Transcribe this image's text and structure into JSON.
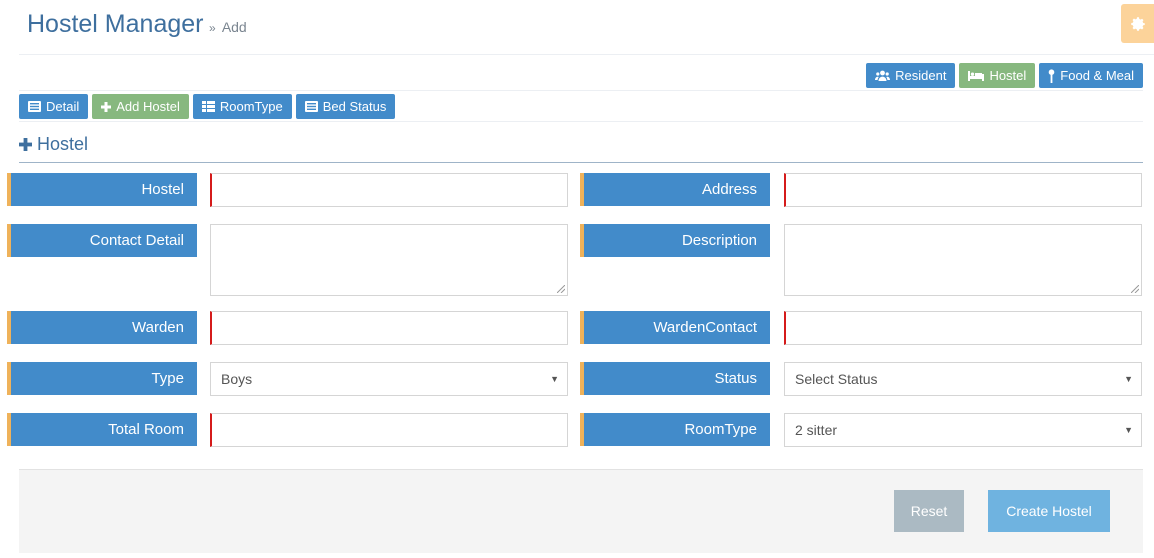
{
  "header": {
    "title": "Hostel Manager",
    "breadcrumb_sep": "»",
    "breadcrumb": "Add",
    "settings_icon": "gear-icon"
  },
  "topnav": [
    {
      "label": "Resident",
      "icon": "users-icon",
      "color": "#428bca"
    },
    {
      "label": "Hostel",
      "icon": "bed-icon",
      "color": "#87b87f"
    },
    {
      "label": "Food & Meal",
      "icon": "key-icon",
      "color": "#428bca"
    }
  ],
  "subnav": [
    {
      "label": "Detail",
      "icon": "list-icon",
      "color": "#428bca"
    },
    {
      "label": "Add Hostel",
      "icon": "plus-icon",
      "color": "#87b87f"
    },
    {
      "label": "RoomType",
      "icon": "table-icon",
      "color": "#428bca"
    },
    {
      "label": "Bed Status",
      "icon": "list-icon",
      "color": "#428bca"
    }
  ],
  "section": {
    "title": "Hostel",
    "icon": "plus-icon"
  },
  "form": {
    "hostel": {
      "label": "Hostel",
      "value": ""
    },
    "address": {
      "label": "Address",
      "value": ""
    },
    "contact_detail": {
      "label": "Contact Detail",
      "value": ""
    },
    "description": {
      "label": "Description",
      "value": ""
    },
    "warden": {
      "label": "Warden",
      "value": ""
    },
    "warden_contact": {
      "label": "WardenContact",
      "value": ""
    },
    "type": {
      "label": "Type",
      "selected": "Boys"
    },
    "status": {
      "label": "Status",
      "selected": "Select Status"
    },
    "total_room": {
      "label": "Total Room",
      "value": ""
    },
    "room_type": {
      "label": "RoomType",
      "selected": "2 sitter"
    }
  },
  "actions": {
    "reset": "Reset",
    "create": "Create Hostel"
  },
  "colors": {
    "primary": "#428bca",
    "success": "#87b87f",
    "accent": "#efb25a",
    "required": "#d51b1b"
  }
}
